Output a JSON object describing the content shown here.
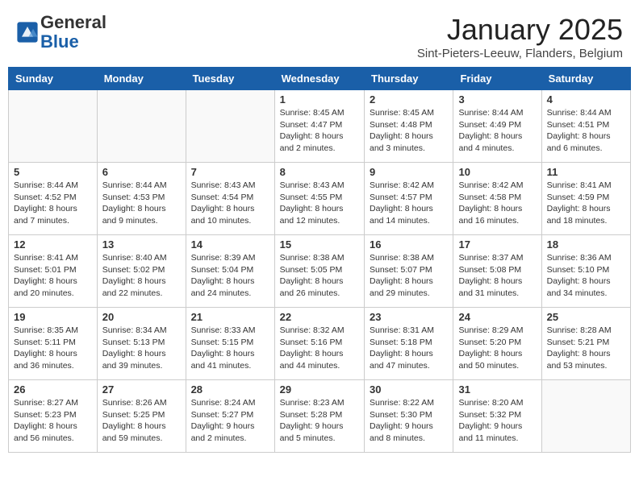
{
  "header": {
    "logo_general": "General",
    "logo_blue": "Blue",
    "title": "January 2025",
    "location": "Sint-Pieters-Leeuw, Flanders, Belgium"
  },
  "days_of_week": [
    "Sunday",
    "Monday",
    "Tuesday",
    "Wednesday",
    "Thursday",
    "Friday",
    "Saturday"
  ],
  "weeks": [
    [
      {
        "day": "",
        "info": ""
      },
      {
        "day": "",
        "info": ""
      },
      {
        "day": "",
        "info": ""
      },
      {
        "day": "1",
        "info": "Sunrise: 8:45 AM\nSunset: 4:47 PM\nDaylight: 8 hours and 2 minutes."
      },
      {
        "day": "2",
        "info": "Sunrise: 8:45 AM\nSunset: 4:48 PM\nDaylight: 8 hours and 3 minutes."
      },
      {
        "day": "3",
        "info": "Sunrise: 8:44 AM\nSunset: 4:49 PM\nDaylight: 8 hours and 4 minutes."
      },
      {
        "day": "4",
        "info": "Sunrise: 8:44 AM\nSunset: 4:51 PM\nDaylight: 8 hours and 6 minutes."
      }
    ],
    [
      {
        "day": "5",
        "info": "Sunrise: 8:44 AM\nSunset: 4:52 PM\nDaylight: 8 hours and 7 minutes."
      },
      {
        "day": "6",
        "info": "Sunrise: 8:44 AM\nSunset: 4:53 PM\nDaylight: 8 hours and 9 minutes."
      },
      {
        "day": "7",
        "info": "Sunrise: 8:43 AM\nSunset: 4:54 PM\nDaylight: 8 hours and 10 minutes."
      },
      {
        "day": "8",
        "info": "Sunrise: 8:43 AM\nSunset: 4:55 PM\nDaylight: 8 hours and 12 minutes."
      },
      {
        "day": "9",
        "info": "Sunrise: 8:42 AM\nSunset: 4:57 PM\nDaylight: 8 hours and 14 minutes."
      },
      {
        "day": "10",
        "info": "Sunrise: 8:42 AM\nSunset: 4:58 PM\nDaylight: 8 hours and 16 minutes."
      },
      {
        "day": "11",
        "info": "Sunrise: 8:41 AM\nSunset: 4:59 PM\nDaylight: 8 hours and 18 minutes."
      }
    ],
    [
      {
        "day": "12",
        "info": "Sunrise: 8:41 AM\nSunset: 5:01 PM\nDaylight: 8 hours and 20 minutes."
      },
      {
        "day": "13",
        "info": "Sunrise: 8:40 AM\nSunset: 5:02 PM\nDaylight: 8 hours and 22 minutes."
      },
      {
        "day": "14",
        "info": "Sunrise: 8:39 AM\nSunset: 5:04 PM\nDaylight: 8 hours and 24 minutes."
      },
      {
        "day": "15",
        "info": "Sunrise: 8:38 AM\nSunset: 5:05 PM\nDaylight: 8 hours and 26 minutes."
      },
      {
        "day": "16",
        "info": "Sunrise: 8:38 AM\nSunset: 5:07 PM\nDaylight: 8 hours and 29 minutes."
      },
      {
        "day": "17",
        "info": "Sunrise: 8:37 AM\nSunset: 5:08 PM\nDaylight: 8 hours and 31 minutes."
      },
      {
        "day": "18",
        "info": "Sunrise: 8:36 AM\nSunset: 5:10 PM\nDaylight: 8 hours and 34 minutes."
      }
    ],
    [
      {
        "day": "19",
        "info": "Sunrise: 8:35 AM\nSunset: 5:11 PM\nDaylight: 8 hours and 36 minutes."
      },
      {
        "day": "20",
        "info": "Sunrise: 8:34 AM\nSunset: 5:13 PM\nDaylight: 8 hours and 39 minutes."
      },
      {
        "day": "21",
        "info": "Sunrise: 8:33 AM\nSunset: 5:15 PM\nDaylight: 8 hours and 41 minutes."
      },
      {
        "day": "22",
        "info": "Sunrise: 8:32 AM\nSunset: 5:16 PM\nDaylight: 8 hours and 44 minutes."
      },
      {
        "day": "23",
        "info": "Sunrise: 8:31 AM\nSunset: 5:18 PM\nDaylight: 8 hours and 47 minutes."
      },
      {
        "day": "24",
        "info": "Sunrise: 8:29 AM\nSunset: 5:20 PM\nDaylight: 8 hours and 50 minutes."
      },
      {
        "day": "25",
        "info": "Sunrise: 8:28 AM\nSunset: 5:21 PM\nDaylight: 8 hours and 53 minutes."
      }
    ],
    [
      {
        "day": "26",
        "info": "Sunrise: 8:27 AM\nSunset: 5:23 PM\nDaylight: 8 hours and 56 minutes."
      },
      {
        "day": "27",
        "info": "Sunrise: 8:26 AM\nSunset: 5:25 PM\nDaylight: 8 hours and 59 minutes."
      },
      {
        "day": "28",
        "info": "Sunrise: 8:24 AM\nSunset: 5:27 PM\nDaylight: 9 hours and 2 minutes."
      },
      {
        "day": "29",
        "info": "Sunrise: 8:23 AM\nSunset: 5:28 PM\nDaylight: 9 hours and 5 minutes."
      },
      {
        "day": "30",
        "info": "Sunrise: 8:22 AM\nSunset: 5:30 PM\nDaylight: 9 hours and 8 minutes."
      },
      {
        "day": "31",
        "info": "Sunrise: 8:20 AM\nSunset: 5:32 PM\nDaylight: 9 hours and 11 minutes."
      },
      {
        "day": "",
        "info": ""
      }
    ]
  ]
}
